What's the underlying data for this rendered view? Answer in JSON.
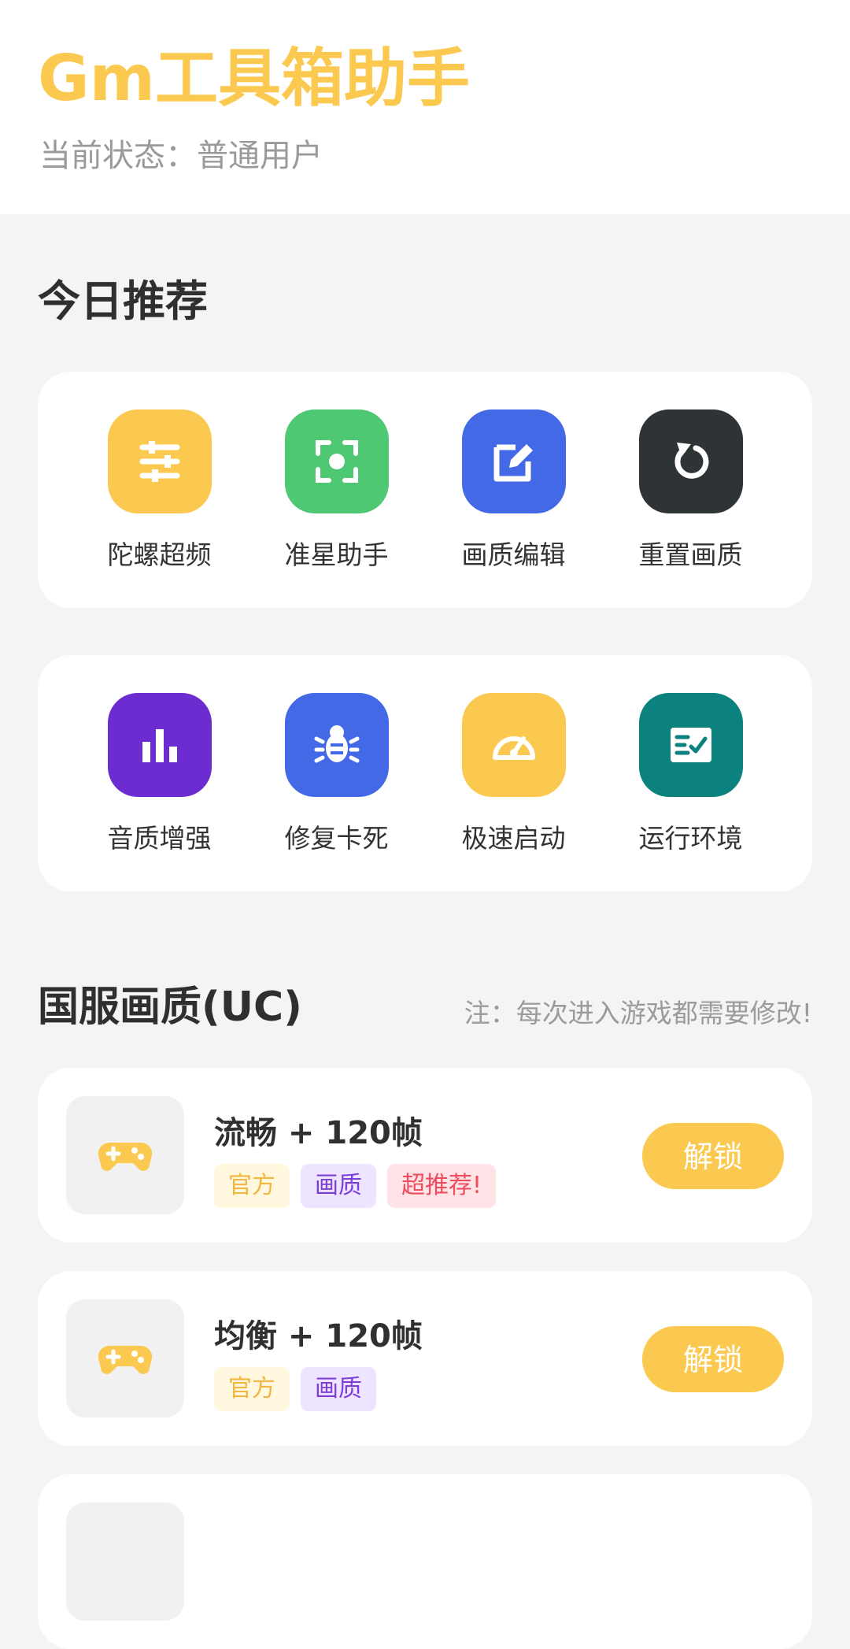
{
  "header": {
    "title": "Gm工具箱助手",
    "status_text": "当前状态：普通用户"
  },
  "recommend": {
    "title": "今日推荐",
    "rows": [
      [
        {
          "label": "陀螺超频",
          "icon": "sliders-icon",
          "color": "#FBC94F"
        },
        {
          "label": "准星助手",
          "icon": "crosshair-focus-icon",
          "color": "#4FC873"
        },
        {
          "label": "画质编辑",
          "icon": "edit-icon",
          "color": "#4369E6"
        },
        {
          "label": "重置画质",
          "icon": "reset-icon",
          "color": "#2E3436"
        }
      ],
      [
        {
          "label": "音质增强",
          "icon": "bar-chart-icon",
          "color": "#6D2CD0"
        },
        {
          "label": "修复卡死",
          "icon": "bug-icon",
          "color": "#4369E6"
        },
        {
          "label": "极速启动",
          "icon": "speedometer-icon",
          "color": "#FBC94F"
        },
        {
          "label": "运行环境",
          "icon": "checklist-icon",
          "color": "#0B827D"
        }
      ]
    ]
  },
  "section": {
    "title": "国服画质(UC)",
    "note": "注：每次进入游戏都需要修改!"
  },
  "items": [
    {
      "title": "流畅 + 120帧",
      "tags": [
        {
          "text": "官方",
          "type": "official"
        },
        {
          "text": "画质",
          "type": "quality"
        },
        {
          "text": "超推荐!",
          "type": "hot"
        }
      ],
      "button": "解锁"
    },
    {
      "title": "均衡 + 120帧",
      "tags": [
        {
          "text": "官方",
          "type": "official"
        },
        {
          "text": "画质",
          "type": "quality"
        }
      ],
      "button": "解锁"
    }
  ],
  "colors": {
    "accent": "#FBC94F",
    "background": "#F4F4F4"
  }
}
